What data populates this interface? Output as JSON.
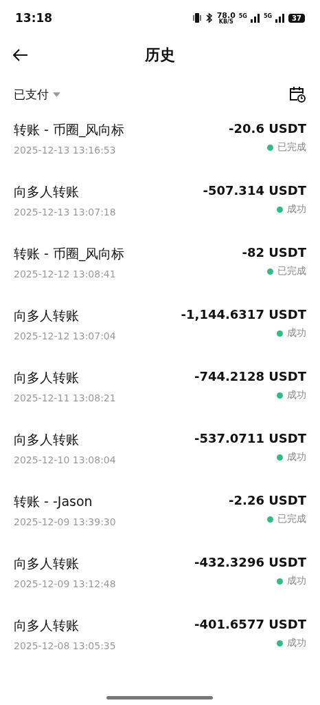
{
  "status_bar": {
    "time": "13:18",
    "speed": "78.0",
    "speed_unit": "KB/S",
    "network_1": "5G",
    "network_2": "5G",
    "battery": "37"
  },
  "header": {
    "title": "历史"
  },
  "filter": {
    "label": "已支付"
  },
  "transactions": [
    {
      "title": "转账 - 币圈_风向标",
      "date": "2025-12-13 13:16:53",
      "amount": "-20.6 USDT",
      "status": "已完成"
    },
    {
      "title": "向多人转账",
      "date": "2025-12-13 13:07:18",
      "amount": "-507.314 USDT",
      "status": "成功"
    },
    {
      "title": "转账 - 币圈_风向标",
      "date": "2025-12-12 13:08:41",
      "amount": "-82 USDT",
      "status": "已完成"
    },
    {
      "title": "向多人转账",
      "date": "2025-12-12 13:07:04",
      "amount": "-1,144.6317 USDT",
      "status": "成功"
    },
    {
      "title": "向多人转账",
      "date": "2025-12-11 13:08:21",
      "amount": "-744.2128 USDT",
      "status": "成功"
    },
    {
      "title": "向多人转账",
      "date": "2025-12-10 13:08:04",
      "amount": "-537.0711 USDT",
      "status": "成功"
    },
    {
      "title": "转账 - -Jason",
      "date": "2025-12-09 13:39:30",
      "amount": "-2.26 USDT",
      "status": "已完成"
    },
    {
      "title": "向多人转账",
      "date": "2025-12-09 13:12:48",
      "amount": "-432.3296 USDT",
      "status": "成功"
    },
    {
      "title": "向多人转账",
      "date": "2025-12-08 13:05:35",
      "amount": "-401.6577 USDT",
      "status": "成功"
    }
  ]
}
